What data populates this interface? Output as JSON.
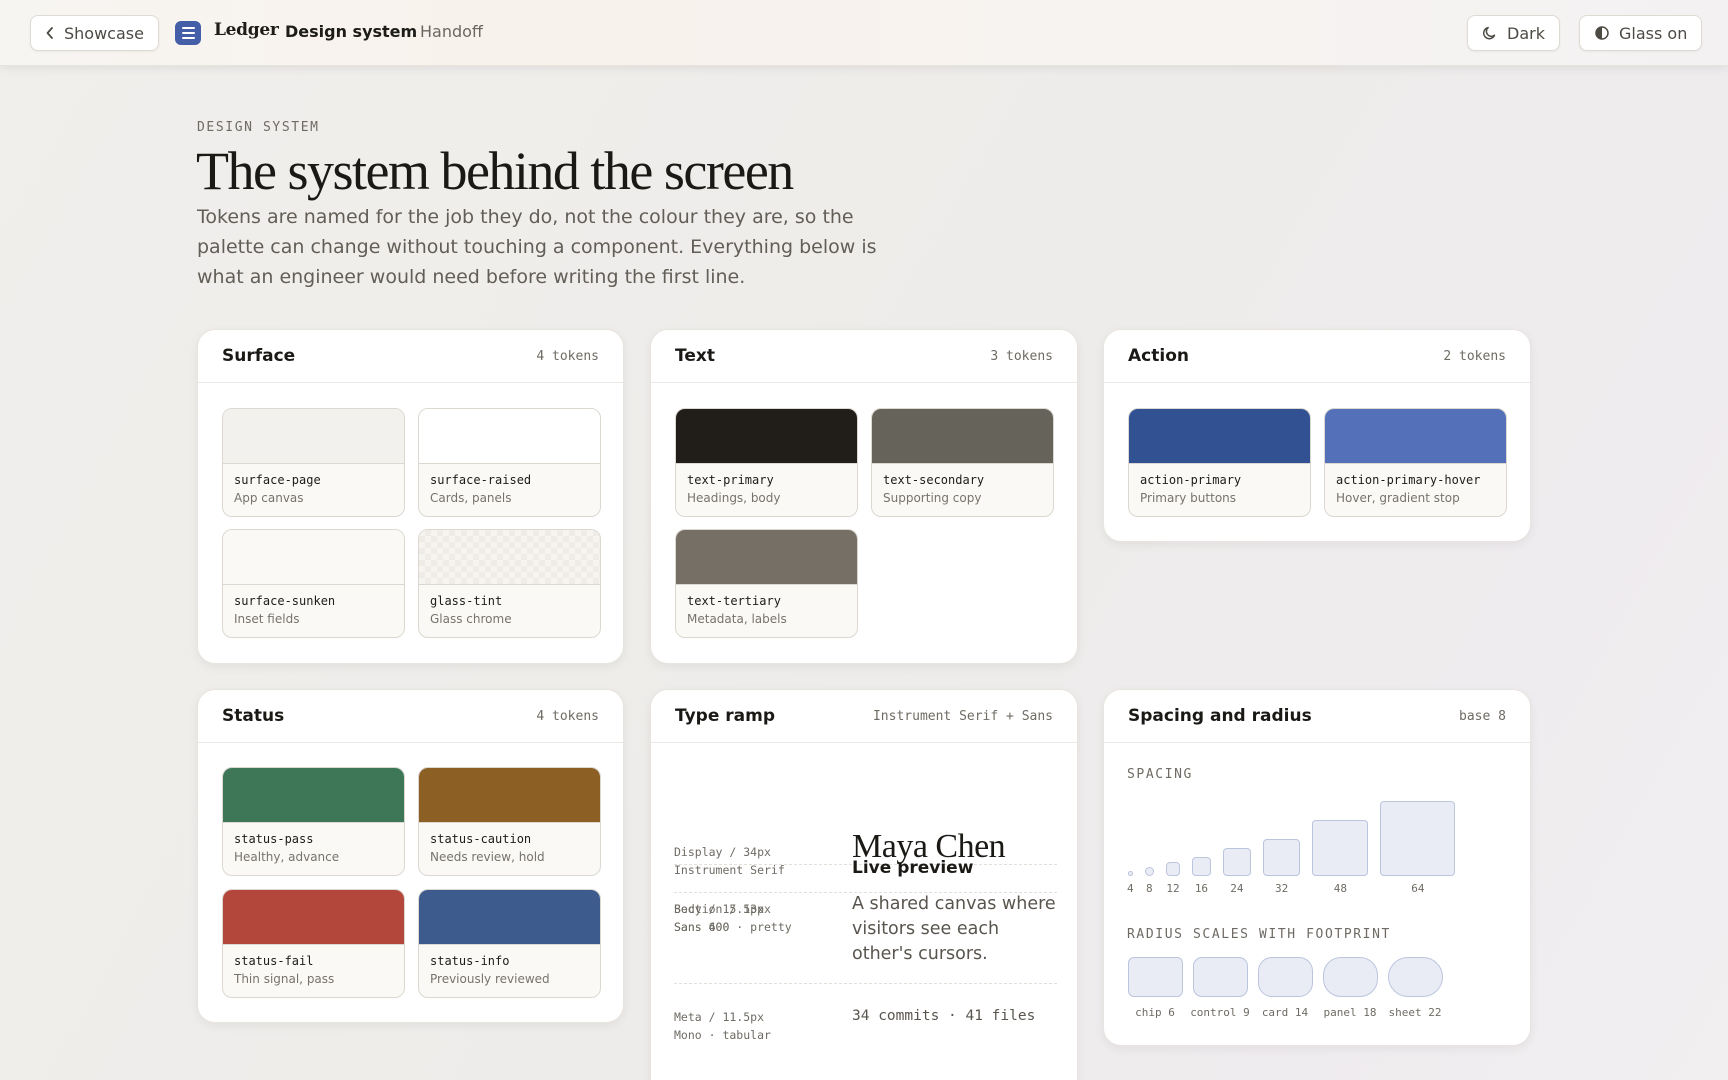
{
  "topbar": {
    "back_label": "Showcase",
    "brand": "Ledger",
    "crumb_current": "Design system",
    "crumb_next": "Handoff",
    "dark_label": "Dark",
    "glass_label": "Glass on",
    "brand_color": "#445ea8"
  },
  "hero": {
    "eyebrow": "DESIGN SYSTEM",
    "title": "The system behind the screen",
    "lede": "Tokens are named for the job they do, not the colour they are, so the palette can change without touching a component. Everything below is what an engineer would need before writing the first line."
  },
  "surface": {
    "title": "Surface",
    "meta": "4 tokens",
    "tokens": [
      {
        "name": "surface-page",
        "desc": "App canvas",
        "color": "#f3f1ee"
      },
      {
        "name": "surface-raised",
        "desc": "Cards, panels",
        "color": "#ffffff"
      },
      {
        "name": "surface-sunken",
        "desc": "Inset fields",
        "color": "#faf9f6"
      },
      {
        "name": "glass-tint",
        "desc": "Glass chrome",
        "color": "#f6f4f1"
      }
    ]
  },
  "text": {
    "title": "Text",
    "meta": "3 tokens",
    "tokens": [
      {
        "name": "text-primary",
        "desc": "Headings, body",
        "color": "#211e19"
      },
      {
        "name": "text-secondary",
        "desc": "Supporting copy",
        "color": "#66635b"
      },
      {
        "name": "text-tertiary",
        "desc": "Metadata, labels",
        "color": "#766f65"
      }
    ]
  },
  "action": {
    "title": "Action",
    "meta": "2 tokens",
    "tokens": [
      {
        "name": "action-primary",
        "desc": "Primary buttons",
        "color": "#325193"
      },
      {
        "name": "action-primary-hover",
        "desc": "Hover, gradient stop",
        "color": "#5470b8"
      }
    ]
  },
  "status": {
    "title": "Status",
    "meta": "4 tokens",
    "tokens": [
      {
        "name": "status-pass",
        "desc": "Healthy, advance",
        "color": "#3d7757"
      },
      {
        "name": "status-caution",
        "desc": "Needs review, hold",
        "color": "#8c5f25"
      },
      {
        "name": "status-fail",
        "desc": "Thin signal, pass",
        "color": "#b3473c"
      },
      {
        "name": "status-info",
        "desc": "Previously reviewed",
        "color": "#3e5b8e"
      }
    ]
  },
  "type_ramp": {
    "title": "Type ramp",
    "meta": "Instrument Serif + Sans",
    "rows": [
      {
        "label_1": "Display / 34px",
        "label_2": "Instrument Serif",
        "sample": "Maya Chen"
      },
      {
        "label_1": "Section / 13px",
        "label_2": "Sans 600",
        "sample": "Live preview"
      },
      {
        "label_1": "Body / 15.5px",
        "label_2": "Sans 400 · pretty",
        "sample": "A shared canvas where visitors see each other's cursors."
      },
      {
        "label_1": "Meta / 11.5px",
        "label_2": "Mono · tabular",
        "sample": "34 commits · 41 files"
      }
    ]
  },
  "spacing": {
    "title": "Spacing and radius",
    "meta": "base 8",
    "spacing_caption": "SPACING",
    "steps": [
      4,
      8,
      12,
      16,
      24,
      32,
      48,
      64
    ],
    "step_labels": [
      "4",
      "8",
      "12",
      "16",
      "24",
      "32",
      "48",
      "64"
    ],
    "radius_caption": "RADIUS SCALES WITH FOOTPRINT",
    "radii": [
      {
        "label": "chip 6",
        "value": 6
      },
      {
        "label": "control 9",
        "value": 9
      },
      {
        "label": "card 14",
        "value": 14
      },
      {
        "label": "panel 18",
        "value": 18
      },
      {
        "label": "sheet 22",
        "value": 22
      }
    ]
  }
}
